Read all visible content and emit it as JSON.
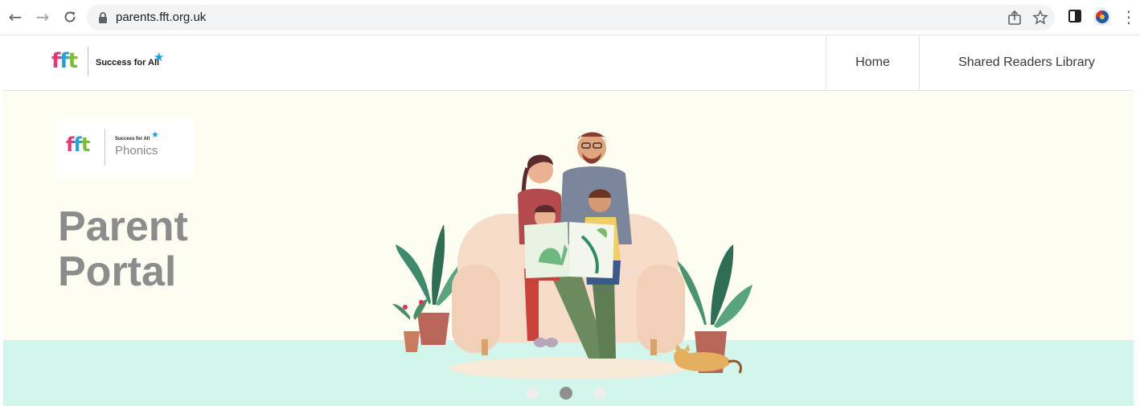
{
  "browser": {
    "url": "parents.fft.org.uk",
    "icons": [
      "back-arrow-icon",
      "forward-arrow-icon",
      "reload-icon",
      "lock-icon",
      "share-icon",
      "bookmark-star-icon",
      "side-panel-icon",
      "profile-avatar-icon",
      "kebab-menu-icon"
    ]
  },
  "header": {
    "logo_letters": [
      "f",
      "f",
      "t"
    ],
    "logo_colors": [
      "#e0397a",
      "#2b9fd8",
      "#7dbb2f"
    ],
    "logo_tagline": "Success for All",
    "nav": [
      {
        "label": "Home"
      },
      {
        "label": "Shared Readers Library"
      }
    ]
  },
  "hero": {
    "card": {
      "tagline": "Success for All",
      "product": "Phonics"
    },
    "title_line1": "Parent",
    "title_line2": "Portal",
    "background_color": "#fdfdf1",
    "floor_color": "#d2f5ec",
    "carousel": {
      "slide_count": 3,
      "active_index": 1
    }
  }
}
